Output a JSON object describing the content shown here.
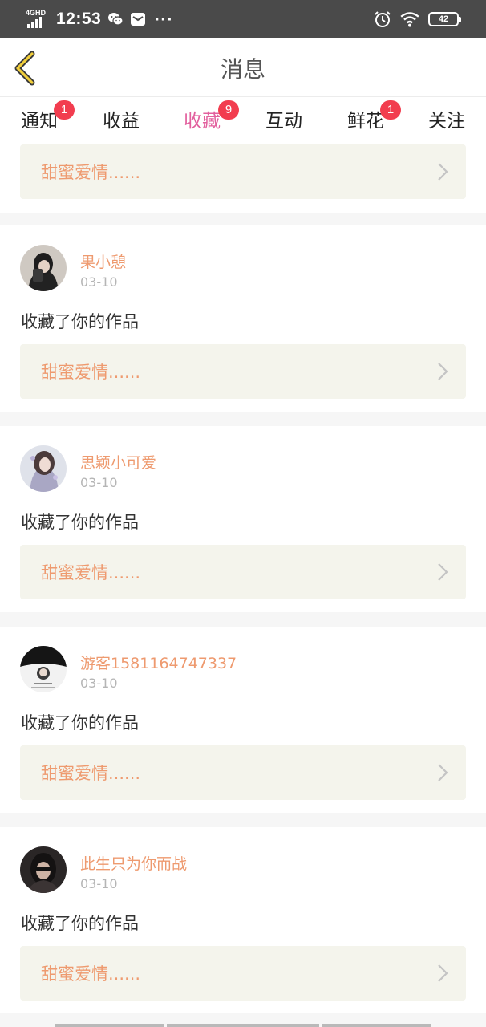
{
  "status": {
    "network": "4G HD",
    "time": "12:53",
    "battery": "42"
  },
  "header": {
    "title": "消息"
  },
  "tabs": [
    {
      "label": "通知",
      "badge": "1"
    },
    {
      "label": "收益",
      "badge": ""
    },
    {
      "label": "收藏",
      "badge": "9",
      "active": true
    },
    {
      "label": "互动",
      "badge": ""
    },
    {
      "label": "鲜花",
      "badge": "1"
    },
    {
      "label": "关注",
      "badge": ""
    }
  ],
  "top_work": {
    "title": "甜蜜爱情......"
  },
  "items": [
    {
      "name": "果小憩",
      "date": "03-10",
      "message": "收藏了你的作品",
      "work": "甜蜜爱情......"
    },
    {
      "name": "思颖小可爱",
      "date": "03-10",
      "message": "收藏了你的作品",
      "work": "甜蜜爱情......"
    },
    {
      "name": "游客1581164747337",
      "date": "03-10",
      "message": "收藏了你的作品",
      "work": "甜蜜爱情......"
    },
    {
      "name": "此生只为你而战",
      "date": "03-10",
      "message": "收藏了你的作品",
      "work": "甜蜜爱情......"
    }
  ],
  "colors": {
    "accent": "#e2609e",
    "badge": "#f23d4f",
    "username": "#ee9a6f",
    "statusbar": "#4a4a4a"
  }
}
